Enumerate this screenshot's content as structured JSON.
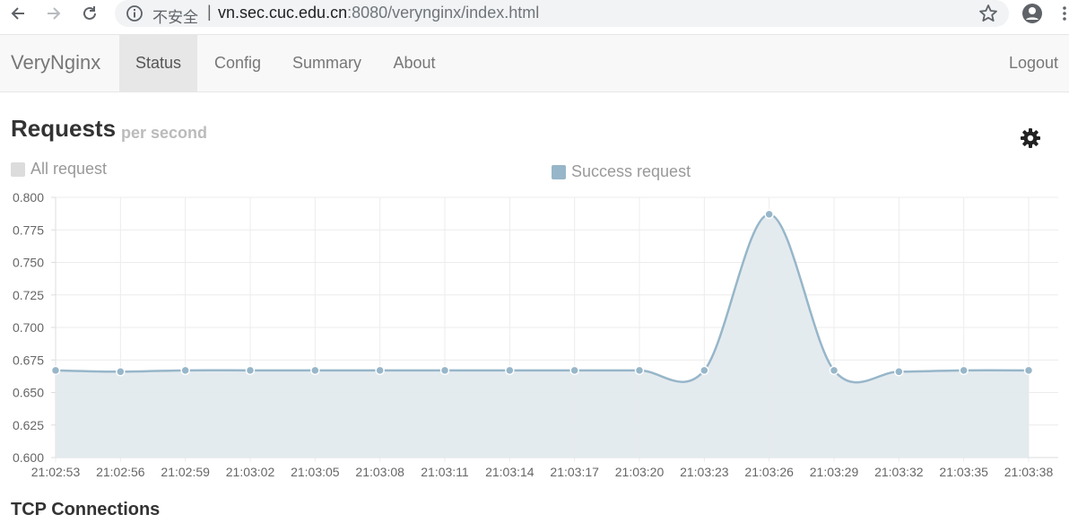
{
  "browser": {
    "security_label": "不安全",
    "separator": "|",
    "url_host": "vn.sec.cuc.edu.cn",
    "url_rest": ":8080/verynginx/index.html"
  },
  "navbar": {
    "brand": "VeryNginx",
    "items": [
      {
        "label": "Status",
        "active": true
      },
      {
        "label": "Config",
        "active": false
      },
      {
        "label": "Summary",
        "active": false
      },
      {
        "label": "About",
        "active": false
      }
    ],
    "logout": "Logout"
  },
  "requests": {
    "title": "Requests",
    "subtitle": "per second"
  },
  "tcp": {
    "title": "TCP Connections"
  },
  "icons": {
    "back": "arrow-left-icon",
    "forward": "arrow-right-icon",
    "reload": "reload-icon",
    "info": "info-icon",
    "star": "star-icon",
    "profile": "account-icon",
    "menu": "more-vert-icon",
    "settings": "gear-icon"
  },
  "colors": {
    "success_line": "#97b6c9",
    "success_fill": "#e3eaee",
    "all_swatch": "#dcdcdc",
    "grid": "#ececec"
  },
  "chart_data": {
    "type": "line",
    "categories": [
      "21:02:53",
      "21:02:56",
      "21:02:59",
      "21:03:02",
      "21:03:05",
      "21:03:08",
      "21:03:11",
      "21:03:14",
      "21:03:17",
      "21:03:20",
      "21:03:23",
      "21:03:26",
      "21:03:29",
      "21:03:32",
      "21:03:35",
      "21:03:38"
    ],
    "series": [
      {
        "name": "All request",
        "values": []
      },
      {
        "name": "Success request",
        "values": [
          0.667,
          0.666,
          0.667,
          0.667,
          0.667,
          0.667,
          0.667,
          0.667,
          0.667,
          0.667,
          0.667,
          0.787,
          0.667,
          0.666,
          0.667,
          0.667
        ]
      }
    ],
    "ylim": [
      0.6,
      0.8
    ],
    "yticks": [
      "0.800",
      "0.775",
      "0.750",
      "0.725",
      "0.700",
      "0.675",
      "0.650",
      "0.625",
      "0.600"
    ],
    "grid": true,
    "legend": "top"
  }
}
